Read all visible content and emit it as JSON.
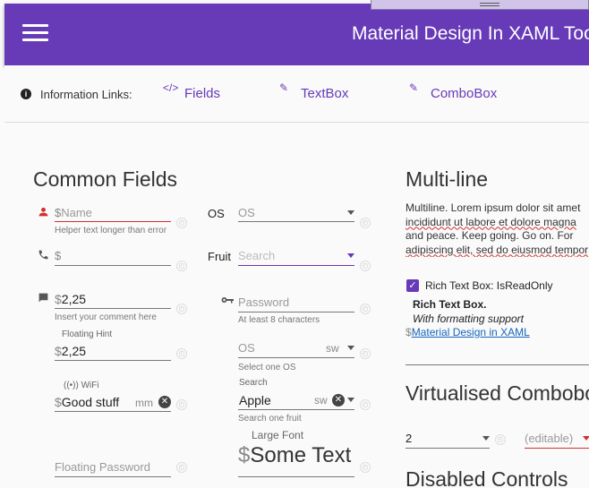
{
  "app": {
    "title": "Material Design In XAML Toolkit"
  },
  "info_bar": {
    "label": "Information Links:",
    "links": [
      {
        "icon": "code-icon",
        "glyph": "</>",
        "label": "Fields"
      },
      {
        "icon": "pencil-icon",
        "glyph": "✎",
        "label": "TextBox"
      },
      {
        "icon": "pencil-icon",
        "glyph": "✎",
        "label": "ComboBox"
      }
    ]
  },
  "common_fields": {
    "title": "Common Fields",
    "name_field": {
      "prefix": "$",
      "placeholder": "Name",
      "helper": "Helper text longer than error"
    },
    "phone_field": {
      "prefix": "$",
      "value": ""
    },
    "comment_field": {
      "prefix": "$",
      "value": "2,25",
      "helper": "Insert your comment here"
    },
    "floating_hint_field": {
      "label": "Floating Hint",
      "prefix": "$",
      "value": "2,25"
    },
    "wifi_field": {
      "label": "WiFi",
      "prefix": "$",
      "value": "Good stuff",
      "suffix": "mm"
    },
    "floating_password": {
      "placeholder": "Floating Password"
    },
    "os_label": "OS",
    "os_combo": {
      "placeholder": "OS"
    },
    "fruit_label": "Fruit",
    "fruit_combo": {
      "placeholder": "Search"
    },
    "password_field": {
      "placeholder": "Password",
      "helper": "At least 8 characters"
    },
    "os_combo2": {
      "placeholder": "OS",
      "suffix": "sw",
      "helper": "Select one OS"
    },
    "search_combo": {
      "label": "Search",
      "value": "Apple",
      "suffix": "sw",
      "helper": "Search one fruit"
    },
    "large_font": {
      "label": "Large Font",
      "prefix": "$",
      "value": "Some Text"
    }
  },
  "multi_line": {
    "title": "Multi-line",
    "lines": [
      "Multiline. Lorem ipsum dolor sit amet",
      "incididunt ut labore et dolore magna",
      "and peace. Keep going. Go on. For",
      "adipiscing elit, sed do eiusmod tempor"
    ],
    "rich_readonly_label": "Rich Text Box: IsReadOnly",
    "rich_readonly_checked": true,
    "rich_title": "Rich Text Box.",
    "rich_subtitle": "With formatting support",
    "rich_prefix": "$",
    "rich_link": "Material Design in XAML"
  },
  "virtualised": {
    "title": "Virtualised Combobox",
    "combo_value": "2",
    "editable_placeholder": "(editable)"
  },
  "disabled": {
    "title": "Disabled Controls"
  },
  "colors": {
    "primary": "#673ab7",
    "error": "#d32f2f",
    "background": "#fafafa"
  }
}
